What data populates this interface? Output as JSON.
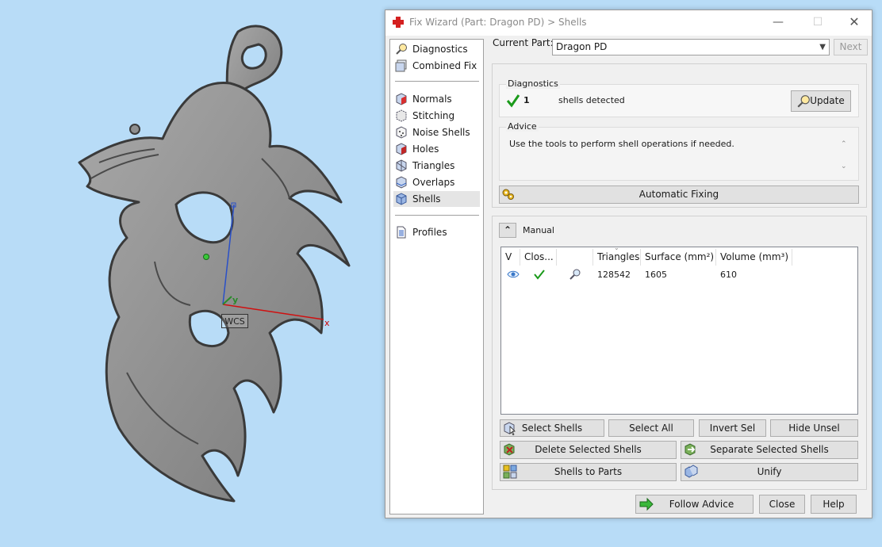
{
  "viewport": {
    "wcs_label": "WCS",
    "axis_x_label": "x",
    "axis_y_label": "y",
    "background_color": "#b8dcf7",
    "model_color": "#8c8c8c"
  },
  "window": {
    "title": "Fix Wizard (Part: Dragon PD) > Shells",
    "icon": "red-cross-icon",
    "minimize_glyph": "—",
    "maximize_glyph": "☐",
    "close_glyph": "✕"
  },
  "nav": {
    "items": [
      {
        "label": "Diagnostics",
        "icon": "magnifier-icon"
      },
      {
        "label": "Combined Fix",
        "icon": "layers-icon"
      },
      {
        "label": "Normals",
        "icon": "normals-cube-icon"
      },
      {
        "label": "Stitching",
        "icon": "stitching-cube-icon"
      },
      {
        "label": "Noise Shells",
        "icon": "noise-cube-icon"
      },
      {
        "label": "Holes",
        "icon": "holes-cube-icon"
      },
      {
        "label": "Triangles",
        "icon": "triangles-cube-icon"
      },
      {
        "label": "Overlaps",
        "icon": "overlaps-cube-icon"
      },
      {
        "label": "Shells",
        "icon": "shells-cube-icon"
      },
      {
        "label": "Profiles",
        "icon": "document-icon"
      }
    ],
    "active": "Shells"
  },
  "current_part": {
    "label": "Current Part:",
    "value": "Dragon PD",
    "next_label": "Next"
  },
  "diagnostics": {
    "label": "Diagnostics",
    "count": "1",
    "status_text": "shells detected",
    "update_label": "Update"
  },
  "advice": {
    "label": "Advice",
    "text": "Use the tools to perform shell operations if needed."
  },
  "automatic_fixing_label": "Automatic Fixing",
  "manual": {
    "label": "Manual",
    "collapse_glyph": "⌃",
    "columns": [
      "V",
      "Clos...",
      "",
      "Triangles",
      "Surface (mm²)",
      "Volume (mm³)"
    ],
    "rows": [
      {
        "triangles": "128542",
        "surface": "1605",
        "volume": "610"
      }
    ],
    "buttons": {
      "select_shells": "Select Shells",
      "select_all": "Select All",
      "invert_sel": "Invert Sel",
      "hide_unsel": "Hide Unsel",
      "delete_selected": "Delete Selected Shells",
      "separate_selected": "Separate Selected Shells",
      "shells_to_parts": "Shells to Parts",
      "unify": "Unify"
    }
  },
  "footer": {
    "follow_advice": "Follow Advice",
    "close": "Close",
    "help": "Help"
  },
  "colors": {
    "check_green": "#1a9a1a",
    "accent_blue": "#4a7fc8"
  }
}
